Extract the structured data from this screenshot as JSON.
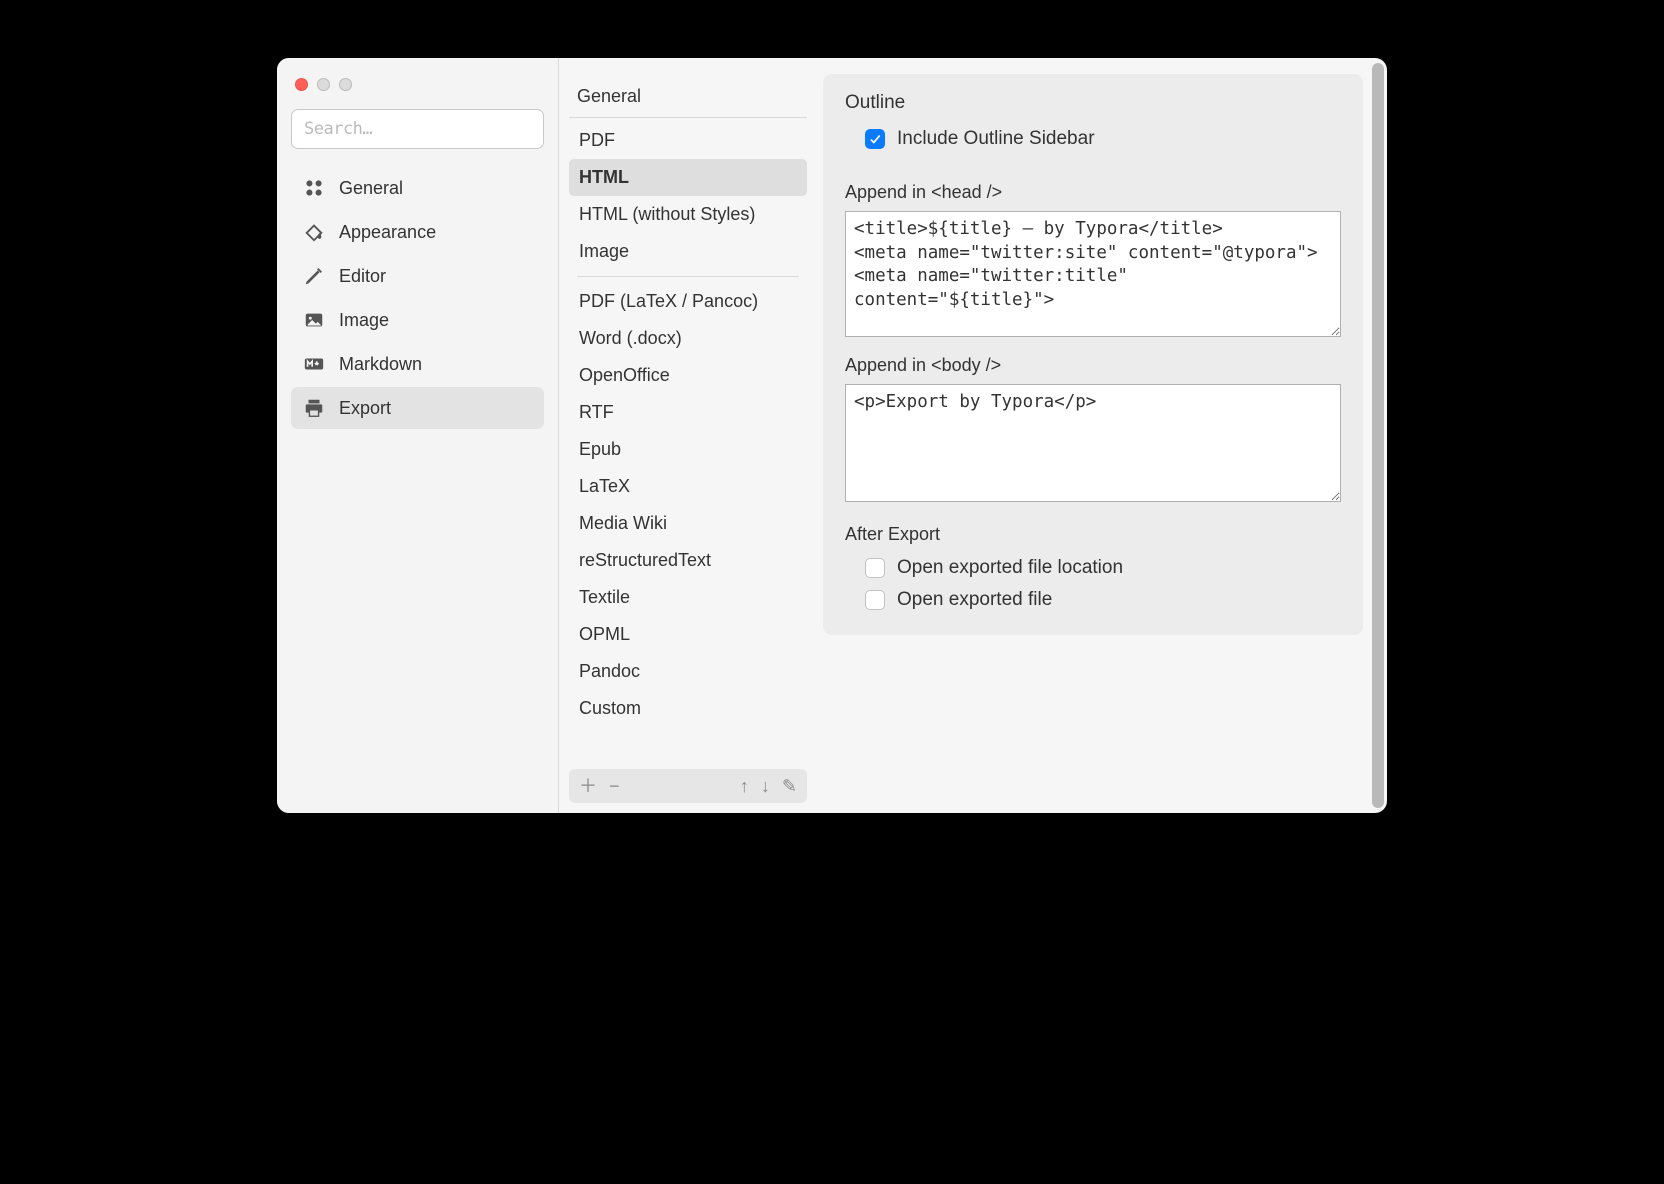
{
  "search": {
    "placeholder": "Search…"
  },
  "sidebar": {
    "items": [
      {
        "label": "General"
      },
      {
        "label": "Appearance"
      },
      {
        "label": "Editor"
      },
      {
        "label": "Image"
      },
      {
        "label": "Markdown"
      },
      {
        "label": "Export"
      }
    ]
  },
  "exportList": {
    "heading": "General",
    "group1": [
      "PDF",
      "HTML",
      "HTML (without Styles)",
      "Image"
    ],
    "group2": [
      "PDF (LaTeX / Pancoc)",
      "Word (.docx)",
      "OpenOffice",
      "RTF",
      "Epub",
      "LaTeX",
      "Media Wiki",
      "reStructuredText",
      "Textile",
      "OPML",
      "Pandoc",
      "Custom"
    ],
    "selected": "HTML"
  },
  "panel": {
    "outline": {
      "title": "Outline",
      "includeSidebar": "Include Outline Sidebar",
      "includeSidebarChecked": true
    },
    "appendHead": {
      "label": "Append in <head />",
      "value": "<title>${title} — by Typora</title>\n<meta name=\"twitter:site\" content=\"@typora\">\n<meta name=\"twitter:title\" content=\"${title}\">"
    },
    "appendBody": {
      "label": "Append in <body />",
      "value": "<p>Export by Typora</p>"
    },
    "afterExport": {
      "title": "After Export",
      "openLocation": "Open exported file location",
      "openFile": "Open exported file",
      "openLocationChecked": false,
      "openFileChecked": false
    }
  }
}
